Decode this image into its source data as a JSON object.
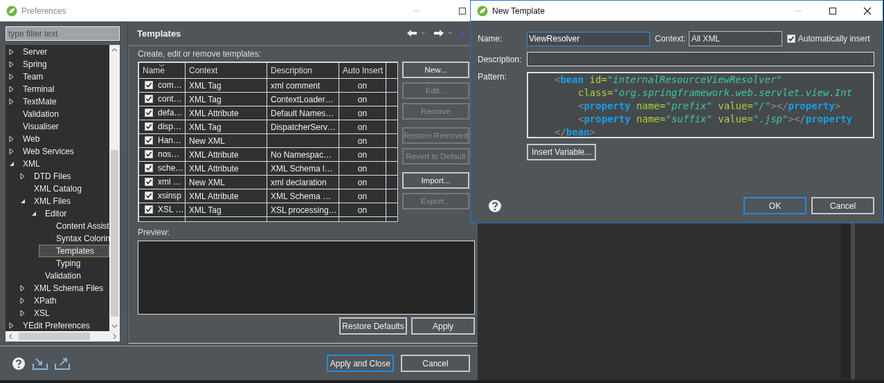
{
  "preferences": {
    "title": "Preferences",
    "filter": {
      "placeholder": "type filter text"
    },
    "tree": [
      {
        "label": "Server",
        "expanded": false,
        "selected": false
      },
      {
        "label": "Spring",
        "expanded": false,
        "selected": false
      },
      {
        "label": "Team",
        "expanded": false,
        "selected": false
      },
      {
        "label": "Terminal",
        "expanded": false,
        "selected": false
      },
      {
        "label": "TextMate",
        "expanded": false,
        "selected": false
      },
      {
        "label": "Validation",
        "selected": false
      },
      {
        "label": "Visualiser",
        "selected": false
      },
      {
        "label": "Web",
        "expanded": false,
        "selected": false
      },
      {
        "label": "Web Services",
        "expanded": false,
        "selected": false
      },
      {
        "label": "XML",
        "expanded": true,
        "selected": false,
        "children": [
          {
            "label": "DTD Files",
            "expanded": false,
            "selected": false
          },
          {
            "label": "XML Catalog",
            "selected": false
          },
          {
            "label": "XML Files",
            "expanded": true,
            "selected": false,
            "children": [
              {
                "label": "Editor",
                "expanded": true,
                "selected": false,
                "children": [
                  {
                    "label": "Content Assist",
                    "selected": false
                  },
                  {
                    "label": "Syntax Colorin",
                    "selected": false
                  },
                  {
                    "label": "Templates",
                    "selected": true
                  },
                  {
                    "label": "Typing",
                    "selected": false
                  }
                ]
              },
              {
                "label": "Validation",
                "selected": false
              }
            ]
          },
          {
            "label": "XML Schema Files",
            "expanded": false,
            "selected": false
          },
          {
            "label": "XPath",
            "expanded": false,
            "selected": false
          },
          {
            "label": "XSL",
            "expanded": false,
            "selected": false
          }
        ]
      },
      {
        "label": "YEdit Preferences",
        "expanded": false,
        "selected": false
      }
    ],
    "page": {
      "title": "Templates",
      "intro": "Create, edit or remove templates:",
      "table": {
        "columns": [
          "Name",
          "Context",
          "Description",
          "Auto Insert"
        ],
        "rows": [
          {
            "checked": true,
            "name": "com…",
            "context": "XML Tag",
            "description": "xml comment",
            "auto_insert": "on"
          },
          {
            "checked": true,
            "name": "cont…",
            "context": "XML Tag",
            "description": "ContextLoader…",
            "auto_insert": "on"
          },
          {
            "checked": true,
            "name": "defa…",
            "context": "XML Attribute",
            "description": "Default Names…",
            "auto_insert": "on"
          },
          {
            "checked": true,
            "name": "disp…",
            "context": "XML Tag",
            "description": "DispatcherServ…",
            "auto_insert": "on"
          },
          {
            "checked": true,
            "name": "Han…",
            "context": "New XML",
            "auto_insert": "on"
          },
          {
            "checked": true,
            "name": "nos…",
            "context": "XML Attribute",
            "description": "No Namespac…",
            "auto_insert": "on"
          },
          {
            "checked": true,
            "name": "sche…",
            "context": "XML Attribute",
            "description": "XML Schema l…",
            "auto_insert": "on"
          },
          {
            "checked": true,
            "name": "xml …",
            "context": "New XML",
            "description": "xml declaration",
            "auto_insert": "on"
          },
          {
            "checked": true,
            "name": "xsinsp",
            "context": "XML Attribute",
            "description": "XML Schema …",
            "auto_insert": "on"
          },
          {
            "checked": true,
            "name": "XSL …",
            "context": "XML Tag",
            "description": "XSL processing…",
            "auto_insert": "on"
          }
        ]
      },
      "side_buttons": [
        [
          {
            "label": "New...",
            "disabled": false
          },
          {
            "label": "Edit...",
            "disabled": true
          },
          {
            "label": "Remove",
            "disabled": true
          }
        ],
        [
          {
            "label": "Restore Removed",
            "disabled": true
          },
          {
            "label": "Revert to Default",
            "disabled": true
          }
        ],
        [
          {
            "label": "Import...",
            "disabled": false
          },
          {
            "label": "Export...",
            "disabled": true
          }
        ]
      ],
      "preview_label": "Preview:",
      "page_buttons": [
        "Restore Defaults",
        "Apply"
      ]
    },
    "buttons": [
      {
        "label": "Apply and Close",
        "default": true
      },
      {
        "label": "Cancel",
        "default": false
      }
    ]
  },
  "dialog": {
    "title": "New Template",
    "name": {
      "label": "Name:",
      "value": "ViewResolver"
    },
    "context": {
      "label": "Context:",
      "value": "All XML"
    },
    "auto_insert": {
      "label": "Automatically insert",
      "checked": true
    },
    "description": {
      "label": "Description:"
    },
    "pattern": {
      "label": "Pattern:",
      "lines": [
        {
          "tokens": [
            {
              "kind": "punct",
              "text": "<"
            },
            {
              "kind": "tag",
              "text": "bean"
            },
            {
              "kind": "attr",
              "text": " id="
            },
            {
              "kind": "value",
              "text": "\"internalResourceViewResolver\""
            }
          ],
          "children": [
            {
              "tokens": [
                {
                  "kind": "attr",
                  "text": "class="
                },
                {
                  "kind": "value",
                  "text": "\"org.springframework.web.servlet.view.Int"
                }
              ]
            },
            {
              "tokens": [
                {
                  "kind": "punct",
                  "text": "<"
                },
                {
                  "kind": "tag",
                  "text": "property"
                },
                {
                  "kind": "attr",
                  "text": " name="
                },
                {
                  "kind": "value",
                  "text": "\"prefix\""
                },
                {
                  "kind": "attr",
                  "text": " value="
                },
                {
                  "kind": "value",
                  "text": "\"/\""
                },
                {
                  "kind": "punct",
                  "text": "></"
                },
                {
                  "kind": "tag",
                  "text": "property"
                },
                {
                  "kind": "punct",
                  "text": ">"
                }
              ]
            },
            {
              "tokens": [
                {
                  "kind": "punct",
                  "text": "<"
                },
                {
                  "kind": "tag",
                  "text": "property"
                },
                {
                  "kind": "attr",
                  "text": " name="
                },
                {
                  "kind": "value",
                  "text": "\"suffix\""
                },
                {
                  "kind": "attr",
                  "text": " value="
                },
                {
                  "kind": "value",
                  "text": "\".jsp\""
                },
                {
                  "kind": "punct",
                  "text": "></"
                },
                {
                  "kind": "tag",
                  "text": "property"
                }
              ]
            }
          ]
        },
        {
          "tokens": [
            {
              "kind": "punct",
              "text": "</"
            },
            {
              "kind": "tag",
              "text": "bean"
            },
            {
              "kind": "punct",
              "text": ">"
            }
          ]
        }
      ]
    },
    "insert_variable": "Insert Variable...",
    "buttons": [
      {
        "label": "OK",
        "default": true
      },
      {
        "label": "Cancel",
        "default": false
      }
    ]
  }
}
